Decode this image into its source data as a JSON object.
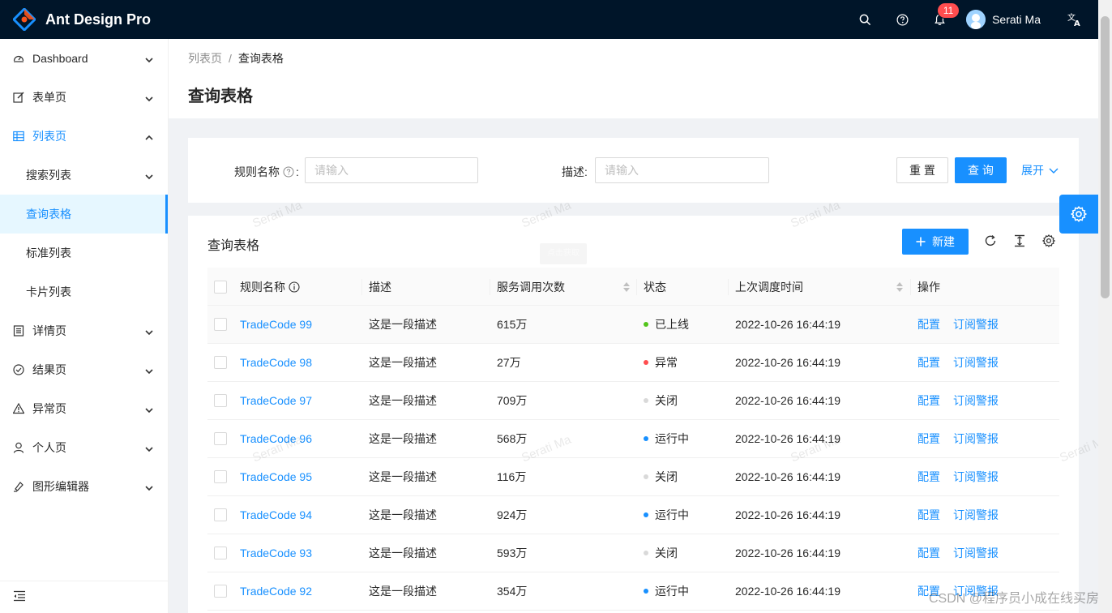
{
  "app": {
    "title": "Ant Design Pro"
  },
  "header": {
    "notification_count": "11",
    "user_name": "Serati Ma"
  },
  "sidebar": {
    "items": [
      {
        "label": "Dashboard",
        "icon": "dashboard-icon",
        "state": "collapsed"
      },
      {
        "label": "表单页",
        "icon": "form-icon",
        "state": "collapsed"
      },
      {
        "label": "列表页",
        "icon": "table-icon",
        "state": "open",
        "children": [
          {
            "label": "搜索列表",
            "has_children": true
          },
          {
            "label": "查询表格",
            "selected": true
          },
          {
            "label": "标准列表"
          },
          {
            "label": "卡片列表"
          }
        ]
      },
      {
        "label": "详情页",
        "icon": "profile-icon",
        "state": "collapsed"
      },
      {
        "label": "结果页",
        "icon": "check-circle-icon",
        "state": "collapsed"
      },
      {
        "label": "异常页",
        "icon": "warning-icon",
        "state": "collapsed"
      },
      {
        "label": "个人页",
        "icon": "user-icon",
        "state": "collapsed"
      },
      {
        "label": "图形编辑器",
        "icon": "highlight-icon",
        "state": "collapsed"
      }
    ]
  },
  "breadcrumb": {
    "parent": "列表页",
    "separator": "/",
    "current": "查询表格"
  },
  "page_title": "查询表格",
  "search": {
    "rule_name_label": "规则名称",
    "rule_name_placeholder": "请输入",
    "desc_label": "描述:",
    "desc_placeholder": "请输入",
    "reset_label": "重 置",
    "query_label": "查 询",
    "expand_label": "展开"
  },
  "table_card": {
    "title": "查询表格",
    "new_label": "新建",
    "tooltip": "点击获取"
  },
  "table": {
    "columns": [
      "规则名称",
      "描述",
      "服务调用次数",
      "状态",
      "上次调度时间",
      "操作"
    ],
    "rows": [
      {
        "name": "TradeCode 99",
        "desc": "这是一段描述",
        "calls": "615万",
        "status": "已上线",
        "status_color": "#52c41a",
        "time": "2022-10-26 16:44:19",
        "action1": "配置",
        "action2": "订阅警报"
      },
      {
        "name": "TradeCode 98",
        "desc": "这是一段描述",
        "calls": "27万",
        "status": "异常",
        "status_color": "#ff4d4f",
        "time": "2022-10-26 16:44:19",
        "action1": "配置",
        "action2": "订阅警报"
      },
      {
        "name": "TradeCode 97",
        "desc": "这是一段描述",
        "calls": "709万",
        "status": "关闭",
        "status_color": "#d9d9d9",
        "time": "2022-10-26 16:44:19",
        "action1": "配置",
        "action2": "订阅警报"
      },
      {
        "name": "TradeCode 96",
        "desc": "这是一段描述",
        "calls": "568万",
        "status": "运行中",
        "status_color": "#1890ff",
        "time": "2022-10-26 16:44:19",
        "action1": "配置",
        "action2": "订阅警报"
      },
      {
        "name": "TradeCode 95",
        "desc": "这是一段描述",
        "calls": "116万",
        "status": "关闭",
        "status_color": "#d9d9d9",
        "time": "2022-10-26 16:44:19",
        "action1": "配置",
        "action2": "订阅警报"
      },
      {
        "name": "TradeCode 94",
        "desc": "这是一段描述",
        "calls": "924万",
        "status": "运行中",
        "status_color": "#1890ff",
        "time": "2022-10-26 16:44:19",
        "action1": "配置",
        "action2": "订阅警报"
      },
      {
        "name": "TradeCode 93",
        "desc": "这是一段描述",
        "calls": "593万",
        "status": "关闭",
        "status_color": "#d9d9d9",
        "time": "2022-10-26 16:44:19",
        "action1": "配置",
        "action2": "订阅警报"
      },
      {
        "name": "TradeCode 92",
        "desc": "这是一段描述",
        "calls": "354万",
        "status": "运行中",
        "status_color": "#1890ff",
        "time": "2022-10-26 16:44:19",
        "action1": "配置",
        "action2": "订阅警报"
      }
    ]
  },
  "watermark": "Serati Ma",
  "credit": "CSDN @程序员小成在线买房",
  "colors": {
    "primary": "#1890ff",
    "header_bg": "#001529"
  }
}
